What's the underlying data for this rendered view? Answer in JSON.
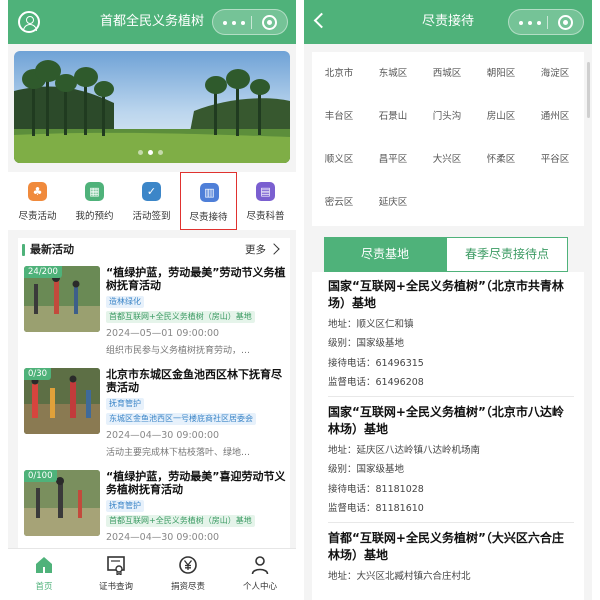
{
  "left": {
    "title": "首都全民义务植树",
    "quicknav": [
      {
        "label": "尽责活动",
        "icon": "tree-icon",
        "color": "#f08a3c"
      },
      {
        "label": "我的预约",
        "icon": "calendar-icon",
        "color": "#4fb27a"
      },
      {
        "label": "活动签到",
        "icon": "checkin-icon",
        "color": "#3c86c8"
      },
      {
        "label": "尽责接待",
        "icon": "building-icon",
        "color": "#4f7fd8"
      },
      {
        "label": "尽责科普",
        "icon": "book-icon",
        "color": "#7a5fd0"
      }
    ],
    "latest": {
      "title": "最新活动",
      "more": "更多",
      "items": [
        {
          "count": "24/200",
          "title": "“植绿护蓝，劳动最美”劳动节义务植树抚育活动",
          "tag1": "造林绿化",
          "tag2": "首都互联网+全民义务植树（房山）基地",
          "time": "2024—05—01 09:00:00",
          "desc": "组织市民参与义务植树抚育劳动，…"
        },
        {
          "count": "0/30",
          "title": "北京市东城区金鱼池西区林下抚育尽责活动",
          "tag1": "抚育管护",
          "tag2": "东城区金鱼池西区一号楼底商社区居委会",
          "time": "2024—04—30 09:00:00",
          "desc": "活动主要完成林下枯枝落叶、绿地…"
        },
        {
          "count": "0/100",
          "title": "“植绿护蓝，劳动最美”喜迎劳动节义务植树抚育活动",
          "tag1": "抚育管护",
          "tag2": "首都互联网+全民义务植树（房山）基地",
          "time": "2024—04—30 09:00:00",
          "desc": ""
        }
      ]
    },
    "tabbar": [
      {
        "label": "首页",
        "icon": "home-icon",
        "active": true
      },
      {
        "label": "证书查询",
        "icon": "certificate-icon",
        "active": false
      },
      {
        "label": "捐资尽责",
        "icon": "yuan-icon",
        "active": false
      },
      {
        "label": "个人中心",
        "icon": "user-icon",
        "active": false
      }
    ]
  },
  "right": {
    "title": "尽责接待",
    "districts": [
      "北京市",
      "东城区",
      "西城区",
      "朝阳区",
      "海淀区",
      "丰台区",
      "石景山",
      "门头沟",
      "房山区",
      "通州区",
      "顺义区",
      "昌平区",
      "大兴区",
      "怀柔区",
      "平谷区",
      "密云区",
      "延庆区"
    ],
    "tabs": [
      "尽责基地",
      "春季尽责接待点"
    ],
    "bases": [
      {
        "name": "国家“互联网+全民义务植树”（北京市共青林场）基地",
        "address": "地址：顺义区仁和镇",
        "level": "级别：国家级基地",
        "phone": "接待电话：61496315",
        "supervise": "监督电话：61496208"
      },
      {
        "name": "国家“互联网+全民义务植树”（北京市八达岭林场）基地",
        "address": "地址：延庆区八达岭镇八达岭机场南",
        "level": "级别：国家级基地",
        "phone": "接待电话：81181028",
        "supervise": "监督电话：81181610"
      },
      {
        "name": "首都“互联网+全民义务植树”（大兴区六合庄林场）基地",
        "address": "地址：大兴区北臧村镇六合庄村北",
        "level": "",
        "phone": "",
        "supervise": ""
      }
    ]
  },
  "colors": {
    "brand": "#4fb27a",
    "highlight": "#e0322f"
  }
}
